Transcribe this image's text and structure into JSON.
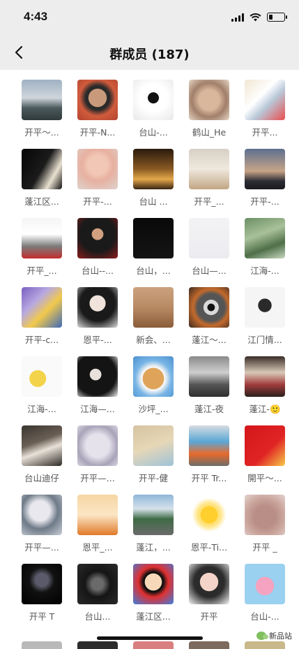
{
  "status_bar": {
    "time": "4:43"
  },
  "header": {
    "title": "群成员 (187)"
  },
  "members": [
    {
      "name": "开平～...",
      "bg": "linear-gradient(180deg,#9fb1c2 0%,#cfd6dc 45%,#4c5a5d 70%,#2f3a3a 100%)"
    },
    {
      "name": "开平-N...",
      "bg": "radial-gradient(circle at 50% 45%,#c89a7b 0 30%,#2a2a2a 31% 40%,#d15b3d 60%,#b2442d 100%)"
    },
    {
      "name": "台山-...",
      "bg": "radial-gradient(circle at 50% 45%,#111 0 18%,#fff 19% 45%,#e8e8e8 100%)"
    },
    {
      "name": "鹤山_He",
      "bg": "radial-gradient(circle at 50% 50%,#d9b79c 0 35%,#a17f6a 60%,#e6d6c5 100%)"
    },
    {
      "name": "开平...",
      "bg": "linear-gradient(135deg,#f0e6d2 0%,#ffffff 40%,#b9c9d9 60%,#e94d4d 100%)"
    },
    {
      "name": "蓬江区...",
      "bg": "linear-gradient(120deg,#050505 0%,#1b1b1b 50%,#e9e1d0 75%,#111 100%)"
    },
    {
      "name": "开平-...",
      "bg": "radial-gradient(circle at 50% 40%,#f2c7b6 0 30%,#e7b0a0 50%,#ded3ce 100%)"
    },
    {
      "name": "台山 ...",
      "bg": "linear-gradient(180deg,#2a1a0d 0%,#8a5a23 50%,#e3a84a 75%,#3a2512 100%)"
    },
    {
      "name": "开平_...",
      "bg": "linear-gradient(180deg,#d8d0c4 0%,#efe8dd 50%,#c2a684 100%)"
    },
    {
      "name": "开平-...",
      "bg": "linear-gradient(180deg,#5d6f8f 0%,#c7a488 55%,#2c2c34 80%,#1a1a1e 100%)"
    },
    {
      "name": "开平_...",
      "bg": "linear-gradient(180deg,#f5f5f5 0%,#ffffff 40%,#7b7b7b 70%,#c52d2d 100%)"
    },
    {
      "name": "台山--...",
      "bg": "radial-gradient(circle at 50% 40%,#d0a080 0 18%,#1a1a1a 19% 55%,#8b1d1d 100%)"
    },
    {
      "name": "台山，...",
      "bg": "linear-gradient(180deg,#090909 0%,#141414 100%)"
    },
    {
      "name": "台山—...",
      "bg": "linear-gradient(180deg,#f3f3f5 0%,#ececf0 100%)"
    },
    {
      "name": "江海-...",
      "bg": "linear-gradient(160deg,#6b8f64 0%,#a9c19a 40%,#4e6f48 70%,#c9d8c0 100%)"
    },
    {
      "name": "开平-c...",
      "bg": "linear-gradient(135deg,#7a5fc0 0%,#b7a9e0 35%,#f2c94c 60%,#3e6ab8 100%)"
    },
    {
      "name": "恩平-...",
      "bg": "radial-gradient(circle at 50% 40%,#efe3dc 0 25%,#1a1a1a 26% 55%,#dcdcdc 100%)"
    },
    {
      "name": "新会、...",
      "bg": "linear-gradient(180deg,#cba27e 0%,#b88a64 50%,#8a5d3b 100%)"
    },
    {
      "name": "蓬江～...",
      "bg": "radial-gradient(circle at 55% 50%,#111 0 12%,#d9d9d9 13% 25%,#555 26% 45%,#c46a2c 60%,#3a2a20 100%)"
    },
    {
      "name": "江门情...",
      "bg": "radial-gradient(circle at 50% 45%,#2a2a2a 0 22%,#f5f5f5 23% 100%)"
    },
    {
      "name": "江海-...",
      "bg": "radial-gradient(circle at 40% 55%,#f3d34a 0 25%,#fafafa 26% 100%)"
    },
    {
      "name": "江海—...",
      "bg": "radial-gradient(circle at 45% 45%,#e8e0da 0 18%,#141414 19% 65%,#f2f2f2 100%)"
    },
    {
      "name": "沙坪_...",
      "bg": "radial-gradient(circle at 50% 55%,#e0a35a 0 35%,#f4f4f4 36% 40%,#7ab6e6 60%,#4a90d0 100%)"
    },
    {
      "name": "蓬江-夜",
      "bg": "linear-gradient(180deg,#8a8a8a 0%,#cfcfcf 40%,#555 70%,#2f2f2f 100%)"
    },
    {
      "name": "蓬江-🙂",
      "bg": "linear-gradient(180deg,#3a2d28 0%,#d9c9b8 40%,#a03c3c 70%,#2a201c 100%)"
    },
    {
      "name": "台山迪仔",
      "bg": "linear-gradient(160deg,#3a3530 0%,#6a5f55 40%,#e9e2d8 60%,#2c2824 100%)"
    },
    {
      "name": "开平—...",
      "bg": "radial-gradient(circle at 50% 50%,#e6e2ec 0 40%,#a9a3b8 70%,#d8d4e0 100%)"
    },
    {
      "name": "开平-健",
      "bg": "linear-gradient(160deg,#d6c3a0 0%,#e6d7b7 50%,#9fc3d8 100%)"
    },
    {
      "name": "开平 Tr...",
      "bg": "linear-gradient(180deg,#d6dbe0 0%,#5aa7d6 40%,#e96a2c 70%,#6c6c6c 100%)"
    },
    {
      "name": "開平～...",
      "bg": "linear-gradient(135deg,#d3161a 0%,#e02424 60%,#f7c948 100%)"
    },
    {
      "name": "开平—...",
      "bg": "radial-gradient(circle at 45% 40%,#e8e8ee 0 30%,#6e7a88 55%,#c9ced6 100%)"
    },
    {
      "name": "恩平_...",
      "bg": "linear-gradient(180deg,#f6d6a4 0%,#fbe6c4 50%,#e07a2a 100%)"
    },
    {
      "name": "蓬江，...",
      "bg": "linear-gradient(180deg,#8fb6d8 0%,#d6e2ea 35%,#3f6b46 60%,#6b6b6b 100%)"
    },
    {
      "name": "恩平-Ti...",
      "bg": "radial-gradient(circle at 50% 50%,#ffcf2e 0 30%,#ffe27a 31% 38%,#fff 60%,#ffffff 100%)"
    },
    {
      "name": "开平 _",
      "bg": "radial-gradient(circle at 50% 55%,#b88e86 0 35%,#c9a39a 60%,#e3d4d0 100%)"
    },
    {
      "name": "开平 T",
      "bg": "radial-gradient(circle at 50% 40%,#5a5a6a 0 20%,#111 40%,#000 100%)"
    },
    {
      "name": "台山...",
      "bg": "radial-gradient(circle at 50% 50%,#6a6a6a 0 20%,#151515 45%,#2a2a2a 100%)"
    },
    {
      "name": "蓬江区...",
      "bg": "radial-gradient(circle at 50% 45%,#f7d8b8 0 28%,#101010 29% 33%,#e03030 50%,#3c7fe0 100%)"
    },
    {
      "name": "开平",
      "bg": "radial-gradient(circle at 50% 45%,#f4d4c8 0 30%,#2b2b2b 31% 50%,#f7f7f7 100%)"
    },
    {
      "name": "台山-...",
      "bg": "radial-gradient(circle at 50% 55%,#f5a3c0 0 30%,#9ad0f0 31% 100%)"
    }
  ],
  "partial_row": [
    {
      "bg": "#b9b9b9"
    },
    {
      "bg": "#2c2c2c"
    },
    {
      "bg": "#d97f7f"
    },
    {
      "bg": "#7c6a5e"
    },
    {
      "bg": "#c9b98a"
    }
  ],
  "watermark": {
    "text": "新品站"
  }
}
